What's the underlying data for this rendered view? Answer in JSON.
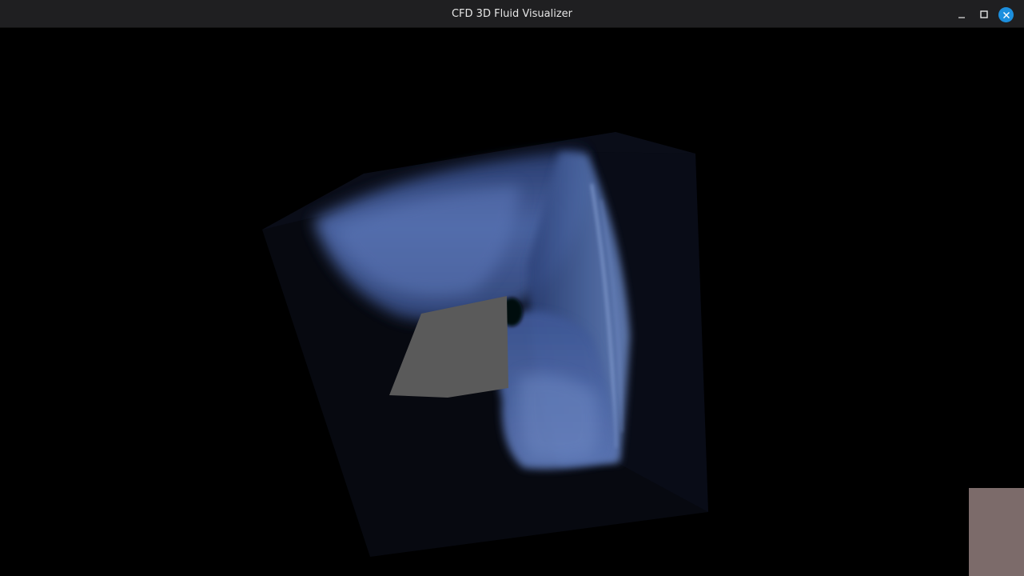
{
  "window": {
    "title": "CFD 3D Fluid Visualizer",
    "controls": {
      "minimize_icon": "minimize-icon",
      "maximize_icon": "maximize-icon",
      "close_icon": "close-icon"
    }
  },
  "viewport": {
    "background": "#000000",
    "volume_color": "#4a66a8",
    "obstacle_color": "#5a5a5a",
    "cube_color": "#080a12"
  },
  "corner_overlay": {
    "color": "#7c6b6a"
  }
}
